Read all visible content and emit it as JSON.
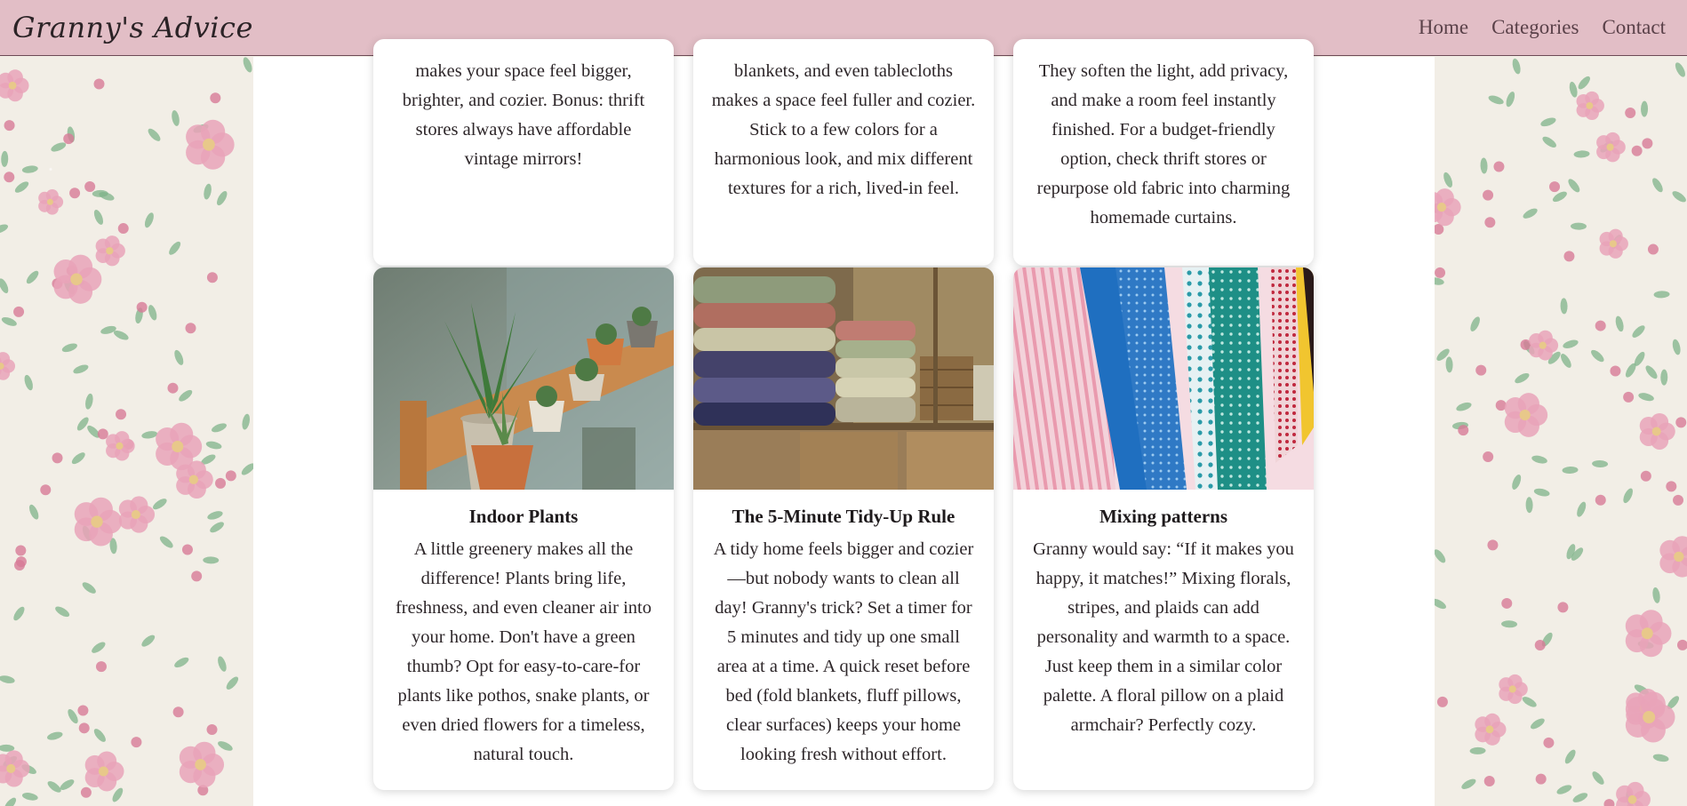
{
  "header": {
    "logo": "Granny's Advice",
    "nav": [
      "Home",
      "Categories",
      "Contact"
    ]
  },
  "top_cards": [
    {
      "text": "makes your space feel bigger, brighter, and cozier. Bonus: thrift stores always have affordable vintage mirrors!"
    },
    {
      "text": "blankets, and even tablecloths makes a space feel fuller and cozier. Stick to a few colors for a harmonious look, and mix different textures for a rich, lived-in feel."
    },
    {
      "text": "They soften the light, add privacy, and make a room feel instantly finished. For a budget-friendly option, check thrift stores or repurpose old fabric into charming homemade curtains."
    }
  ],
  "cards": [
    {
      "title": "Indoor Plants",
      "image": "plants-shelf-image",
      "text": "A little greenery makes all the difference! Plants bring life, freshness, and even cleaner air into your home. Don't have a green thumb? Opt for easy-to-care-for plants like pothos, snake plants, or even dried flowers for a timeless, natural touch."
    },
    {
      "title": "The 5-Minute Tidy-Up Rule",
      "image": "folded-towels-image",
      "text": "A tidy home feels bigger and cozier—but nobody wants to clean all day! Granny's trick? Set a timer for 5 minutes and tidy up one small area at a time. A quick reset before bed (fold blankets, fluff pillows, clear surfaces) keeps your home looking fresh without effort."
    },
    {
      "title": "Mixing patterns",
      "image": "patterned-fabrics-image",
      "text": "Granny would say: “If it makes you happy, it matches!” Mixing florals, stripes, and plaids can add personality and warmth to a space. Just keep them in a similar color palette. A floral pillow on a plaid armchair? Perfectly cozy."
    }
  ],
  "colors": {
    "header_bg": "#e2bec6",
    "page_bg": "#ffffff",
    "floral_pink": "#e9a3b8",
    "floral_green": "#7fb38a"
  }
}
